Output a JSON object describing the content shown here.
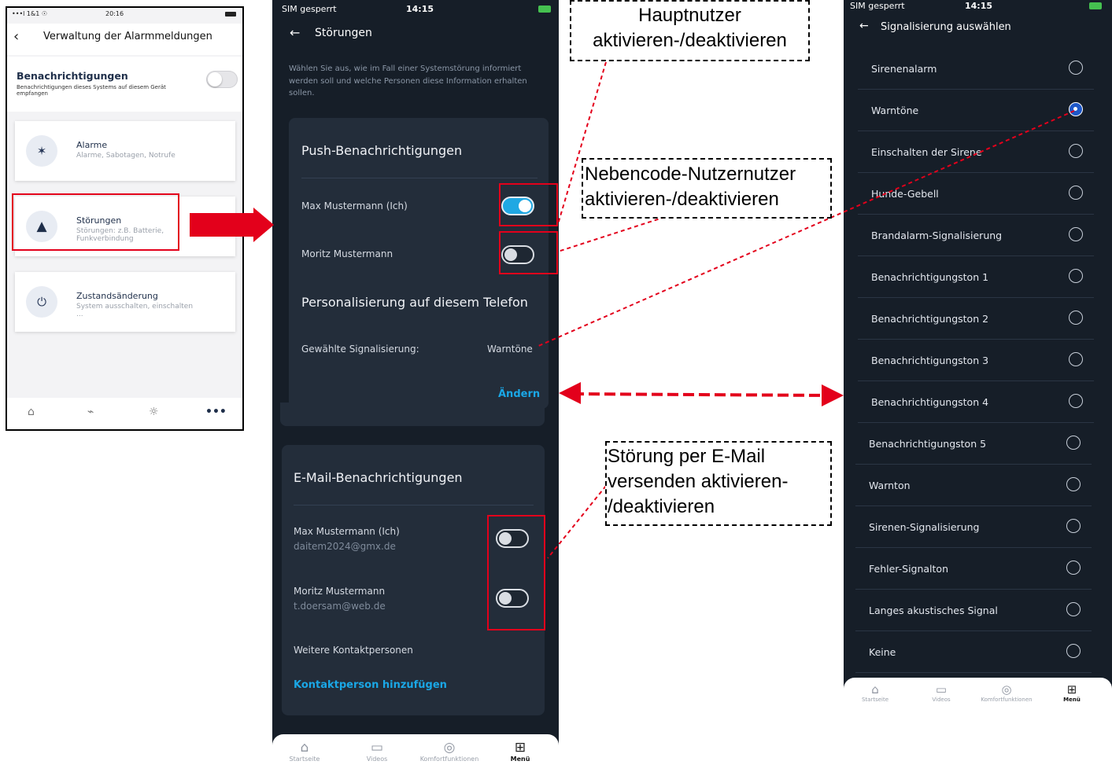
{
  "phone1": {
    "status": {
      "signal": "•••l 1&1 ☉",
      "time": "20:16"
    },
    "title": "Verwaltung der Alarmmeldungen",
    "notifications": {
      "title": "Benachrichtigungen",
      "subtitle": "Benachrichtigungen dieses Systems auf diesem Gerät empfangen",
      "enabled": false
    },
    "cards": [
      {
        "title": "Alarme",
        "subtitle": "Alarme, Sabotagen, Notrufe",
        "icon": "alarm-icon"
      },
      {
        "title": "Störungen",
        "subtitle": "Störungen: z.B. Batterie, Funkverbindung",
        "icon": "warning-icon"
      },
      {
        "title": "Zustandsänderung",
        "subtitle": "System ausschalten, einschalten ...",
        "icon": "power-icon"
      }
    ]
  },
  "phone2": {
    "status": {
      "carrier": "SIM gesperrt",
      "time": "14:15"
    },
    "title": "Störungen",
    "intro": "Wählen Sie aus, wie im Fall einer Systemstörung informiert werden soll und welche Personen diese Information erhalten sollen.",
    "push": {
      "title": "Push-Benachrichtigungen",
      "rows": [
        {
          "name": "Max Mustermann (Ich)",
          "enabled": true
        },
        {
          "name": "Moritz Mustermann",
          "enabled": false
        }
      ]
    },
    "personal": {
      "title": "Personalisierung auf diesem Telefon",
      "label": "Gewählte Signalisierung:",
      "value": "Warntöne",
      "change": "Ändern"
    },
    "email": {
      "title": "E-Mail-Benachrichtigungen",
      "rows": [
        {
          "name": "Max Mustermann (Ich)",
          "email": "daitem2024@gmx.de",
          "enabled": false
        },
        {
          "name": "Moritz Mustermann",
          "email": "t.doersam@web.de",
          "enabled": false
        }
      ],
      "more": "Weitere Kontaktpersonen",
      "add": "Kontaktperson hinzufügen"
    },
    "tabs": [
      {
        "label": "Startseite",
        "icon": "home-icon"
      },
      {
        "label": "Videos",
        "icon": "video-icon"
      },
      {
        "label": "Komfortfunktionen",
        "icon": "comfort-icon"
      },
      {
        "label": "Menü",
        "icon": "menu-grid-icon",
        "active": true
      }
    ]
  },
  "phone3": {
    "status": {
      "carrier": "SIM gesperrt",
      "time": "14:15"
    },
    "title": "Signalisierung auswählen",
    "selected": "Warntöne",
    "options": [
      "Sirenenalarm",
      "Warntöne",
      "Einschalten der Sirene",
      "Hunde-Gebell",
      "Brandalarm-Signalisierung",
      "Benachrichtigungston 1",
      "Benachrichtigungston 2",
      "Benachrichtigungston 3",
      "Benachrichtigungston 4",
      "Benachrichtigungston 5",
      "Warnton",
      "Sirenen-Signalisierung",
      "Fehler-Signalton",
      "Langes akustisches Signal",
      "Keine"
    ],
    "tabs": [
      {
        "label": "Startseite",
        "icon": "home-icon"
      },
      {
        "label": "Videos",
        "icon": "video-icon"
      },
      {
        "label": "Komfortfunktionen",
        "icon": "comfort-icon"
      },
      {
        "label": "Menü",
        "icon": "menu-grid-icon",
        "active": true
      }
    ]
  },
  "annotations": {
    "main_user": [
      "Hauptnutzer",
      "aktivieren-/deaktivieren"
    ],
    "sub_user": [
      "Nebencode-Nutzernutzer",
      "aktivieren-/deaktivieren"
    ],
    "email": [
      "Störung per E-Mail",
      "versenden aktivieren-",
      "/deaktivieren"
    ]
  },
  "colors": {
    "accent": "#1aa7e6",
    "annotation": "#e3001b",
    "dark_bg": "#161e28",
    "panel": "#232d3a"
  }
}
